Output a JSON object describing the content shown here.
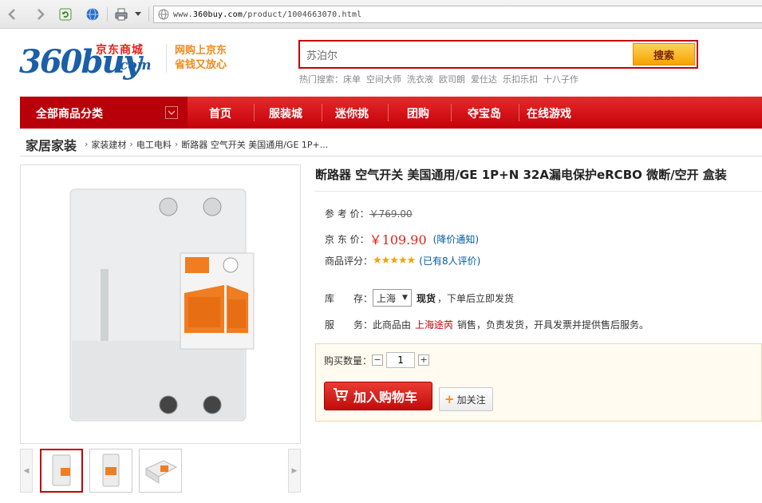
{
  "browser": {
    "url_prefix": "www.",
    "url_domain": "360buy.com",
    "url_path": "/product/1004663070.html"
  },
  "logo": {
    "num": "360",
    "buy": "buy",
    "cn": "京东商城",
    "com": ".com"
  },
  "slogan": {
    "line1": "网购上京东",
    "line2": "省钱又放心"
  },
  "search": {
    "value": "苏泊尔",
    "button": "搜索",
    "hot_label": "热门搜索：",
    "hot_keywords": [
      "床单",
      "空间大师",
      "洗衣液",
      "欧司朗",
      "爱仕达",
      "乐扣乐扣",
      "十八子作"
    ]
  },
  "nav": {
    "all_categories": "全部商品分类",
    "items": [
      "首页",
      "服装城",
      "迷你挑",
      "团购",
      "夺宝岛",
      "在线游戏"
    ]
  },
  "breadcrumb": {
    "main": "家居家装",
    "items": [
      "家装建材",
      "电工电料",
      "断路器 空气开关 美国通用/GE 1P+..."
    ]
  },
  "product": {
    "title": "断路器 空气开关 美国通用/GE 1P+N 32A漏电保护eRCBO 微断/空开 盒装",
    "ref_price_label": "参 考 价：",
    "ref_price": "￥769.00",
    "jd_price_label": "京 东 价：",
    "jd_price": "￥109.90",
    "price_notice": "(降价通知)",
    "rating_label": "商品评分：",
    "rating_stars": "★★★★★",
    "rating_count": "(已有8人评价)",
    "stock_label": "库　　存：",
    "stock_location": "上海",
    "stock_status": "现货",
    "stock_note": "，下单后立即发货",
    "service_label": "服　　务：",
    "service_prefix": "此商品由",
    "seller": "上海途芮",
    "service_suffix": "销售，负责发货，开具发票并提供售后服务。",
    "qty_label": "购买数量：",
    "qty_value": "1",
    "qty_minus": "−",
    "qty_plus": "+",
    "add_to_cart": "加入购物车",
    "follow": "加关注"
  },
  "colors": {
    "brand_red": "#c4000a",
    "brand_blue": "#1a5fa8",
    "accent_orange": "#f08a1c",
    "price_red": "#e2231a",
    "link_blue": "#005aa0"
  }
}
